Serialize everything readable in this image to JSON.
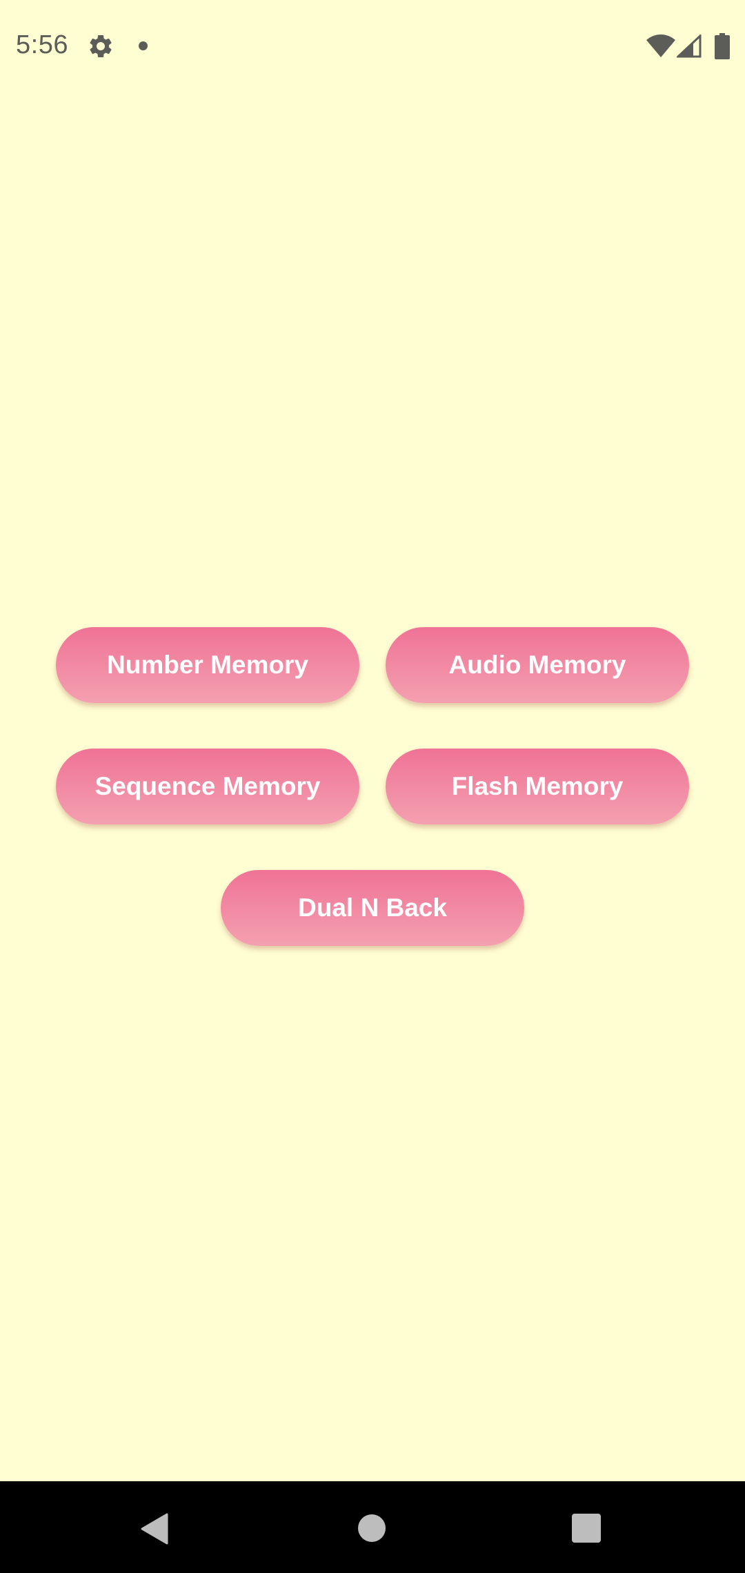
{
  "status_bar": {
    "time": "5:56",
    "icons": [
      "gear-icon",
      "notification-dot-icon",
      "wifi-icon",
      "cell-signal-icon",
      "battery-icon"
    ],
    "text_color": "#5c5c58"
  },
  "menu": {
    "buttons": [
      {
        "label": "Number Memory"
      },
      {
        "label": "Audio Memory"
      },
      {
        "label": "Sequence Memory"
      },
      {
        "label": "Flash Memory"
      },
      {
        "label": "Dual N Back"
      }
    ]
  },
  "navigation_bar": {
    "icons": [
      "back-icon",
      "home-icon",
      "recents-icon"
    ]
  },
  "colors": {
    "background": "#FFFDD2",
    "button_gradient_top": "#EF7396",
    "button_gradient_bottom": "#F4A0B0",
    "button_text": "#FFFFFF",
    "nav_bar": "#000000"
  }
}
